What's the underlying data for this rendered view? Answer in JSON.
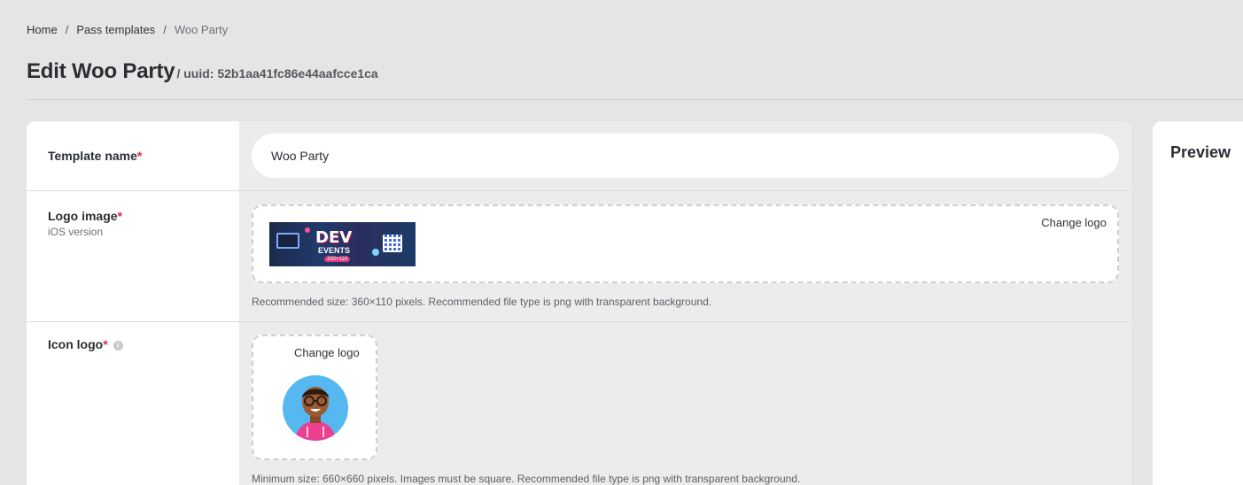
{
  "breadcrumb": {
    "items": [
      "Home",
      "Pass templates",
      "Woo Party"
    ],
    "separator": "/"
  },
  "header": {
    "title": "Edit Woo Party",
    "uuid": "/ uuid: 52b1aa41fc86e44aafcce1ca"
  },
  "form": {
    "template_name": {
      "label": "Template name",
      "required_mark": "*",
      "value": "Woo Party"
    },
    "logo_image": {
      "label": "Logo image",
      "required_mark": "*",
      "sub_label": "iOS version",
      "change_label": "Change logo",
      "hint": "Recommended size: 360×110 pixels. Recommended file type is png with transparent background.",
      "image_text": {
        "dev": "DEV",
        "events": "EVENTS",
        "size_tag": "330×110"
      }
    },
    "icon_logo": {
      "label": "Icon logo",
      "required_mark": "*",
      "info_glyph": "i",
      "change_label": "Change logo",
      "hint": "Minimum size: 660×660 pixels. Images must be square. Recommended file type is png with transparent background."
    }
  },
  "preview": {
    "title": "Preview"
  },
  "colors": {
    "background": "#e6e5e5",
    "required": "#d62d3a",
    "avatar_bg": "#55b8f0",
    "hoodie": "#ec3f8f"
  }
}
